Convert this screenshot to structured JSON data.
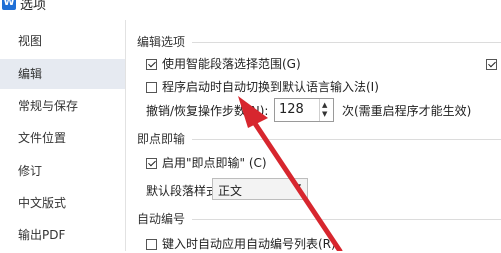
{
  "window": {
    "title": "选项",
    "icon": "app-icon",
    "icon_glyph": "W"
  },
  "sidebar": {
    "items": [
      {
        "label": "视图",
        "active": false
      },
      {
        "label": "编辑",
        "active": true
      },
      {
        "label": "常规与保存",
        "active": false
      },
      {
        "label": "文件位置",
        "active": false
      },
      {
        "label": "修订",
        "active": false
      },
      {
        "label": "中文版式",
        "active": false
      },
      {
        "label": "输出PDF",
        "active": false
      }
    ]
  },
  "edit_options": {
    "title": "编辑选项",
    "smart_paragraph": {
      "label": "使用智能段落选择范围(G)",
      "checked": true
    },
    "auto_switch_ime": {
      "label": "程序启动时自动切换到默认语言输入法(I)",
      "checked": false
    },
    "undo_steps": {
      "label": "撤销/恢复操作步数(N):",
      "value": "128",
      "note": "次(需重启程序才能生效)"
    }
  },
  "click_and_type": {
    "title": "即点即输",
    "enable": {
      "label": "启用\"即点即输\" (C)",
      "checked": true
    },
    "default_style": {
      "label": "默认段落样式(P):",
      "value": "正文"
    }
  },
  "auto_numbering": {
    "title": "自动编号",
    "apply_list": {
      "label": "键入时自动应用自动编号列表(R)",
      "checked": false
    }
  },
  "colors": {
    "annotation_arrow": "#d7262e",
    "sidebar_active": "#e6eaf1"
  }
}
